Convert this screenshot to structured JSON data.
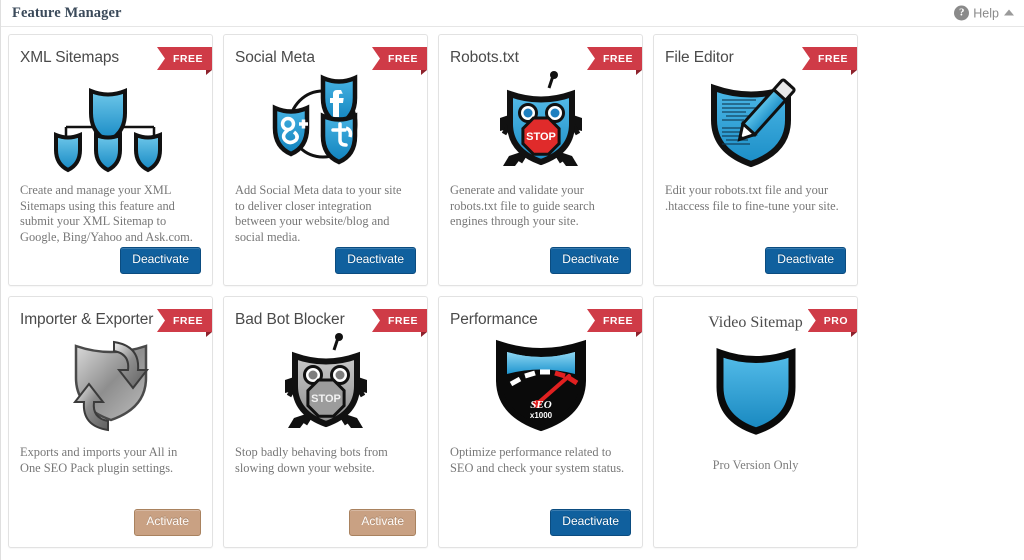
{
  "header": {
    "title": "Feature Manager",
    "help_label": "Help",
    "help_icon": "question-circle-icon",
    "caret_icon": "caret-up-icon"
  },
  "theme": {
    "ribbon_red": "#cf3b47",
    "deactivate_blue": "#10609e",
    "activate_tan": "#c9a183",
    "shield_blue": "#29a3dc",
    "shield_gray": "#9a9a9a",
    "card_border": "#e2e2e2",
    "title_gray": "#4a4a4a",
    "body_gray": "#777777"
  },
  "cards": [
    {
      "title": "XML Sitemaps",
      "ribbon": "FREE",
      "icon": "sitemap-shields-icon",
      "desc": "Create and manage your XML Sitemaps using this feature and submit your XML Sitemap to Google, Bing/Yahoo and Ask.com.",
      "button": "Deactivate",
      "button_state": "deactivate"
    },
    {
      "title": "Social Meta",
      "ribbon": "FREE",
      "icon": "social-shields-icon",
      "desc": "Add Social Meta data to your site to deliver closer integration between your website/blog and social media.",
      "button": "Deactivate",
      "button_state": "deactivate"
    },
    {
      "title": "Robots.txt",
      "ribbon": "FREE",
      "icon": "robot-stop-shield-icon",
      "desc": "Generate and validate your robots.txt file to guide search engines through your site.",
      "button": "Deactivate",
      "button_state": "deactivate"
    },
    {
      "title": "File Editor",
      "ribbon": "FREE",
      "icon": "shield-pencil-icon",
      "desc": "Edit your robots.txt file and your .htaccess file to fine-tune your site.",
      "button": "Deactivate",
      "button_state": "deactivate"
    },
    {
      "title": "Importer & Exporter",
      "ribbon": "FREE",
      "icon": "shield-sync-arrows-icon",
      "desc": "Exports and imports your All in One SEO Pack plugin settings.",
      "button": "Activate",
      "button_state": "activate"
    },
    {
      "title": "Bad Bot Blocker",
      "ribbon": "FREE",
      "icon": "robot-stop-shield-gray-icon",
      "desc": "Stop badly behaving bots from slowing down your website.",
      "button": "Activate",
      "button_state": "activate"
    },
    {
      "title": "Performance",
      "ribbon": "FREE",
      "icon": "speedometer-shield-icon",
      "desc": "Optimize performance related to SEO and check your system status.",
      "gauge_label": "SEO",
      "gauge_sublabel": "x1000",
      "button": "Deactivate",
      "button_state": "deactivate"
    }
  ],
  "pro_card": {
    "title": "Video Sitemap",
    "ribbon": "PRO",
    "icon": "shield-plain-icon",
    "note": "Pro Version Only"
  }
}
